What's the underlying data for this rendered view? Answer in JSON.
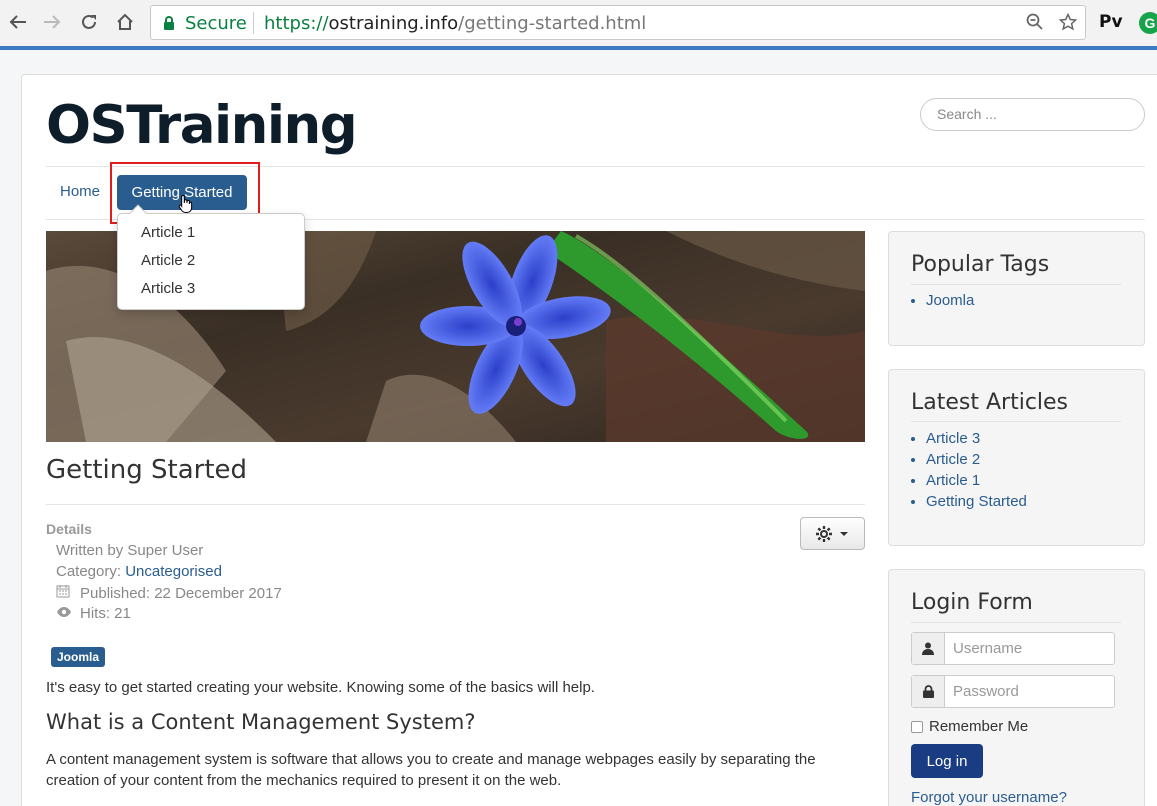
{
  "browser": {
    "secure_label": "Secure",
    "url_scheme": "https://",
    "url_host": "ostraining.info",
    "url_path": "/getting-started.html",
    "extensions": [
      "Pv",
      "G"
    ]
  },
  "site": {
    "brand": "OSTraining",
    "search_placeholder": "Search ..."
  },
  "menu": {
    "home": "Home",
    "active": "Getting Started",
    "dropdown": [
      "Article 1",
      "Article 2",
      "Article 3"
    ]
  },
  "article": {
    "title": "Getting Started",
    "details_label": "Details",
    "written_by": "Written by Super User",
    "category_label": "Category: ",
    "category_value": "Uncategorised",
    "published": "Published: 22 December 2017",
    "hits": "Hits: 21",
    "tag": "Joomla",
    "intro": "It's easy to get started creating your website. Knowing some of the basics will help.",
    "heading": "What is a Content Management System?",
    "para_line1": "A content management system is software that allows you to create and manage webpages easily by separating the",
    "para_line2": "creation of your content from the mechanics required to present it on the web."
  },
  "sidebar": {
    "popular_tags": {
      "title": "Popular Tags",
      "items": [
        "Joomla"
      ]
    },
    "latest_articles": {
      "title": "Latest Articles",
      "items": [
        "Article 3",
        "Article 2",
        "Article 1",
        "Getting Started"
      ]
    },
    "login": {
      "title": "Login Form",
      "username_placeholder": "Username",
      "password_placeholder": "Password",
      "remember": "Remember Me",
      "button": "Log in",
      "forgot": "Forgot your username?"
    }
  },
  "colors": {
    "accent": "#2a5d8f",
    "secure_green": "#0b8043",
    "highlight_red": "#e01e1e",
    "login_button": "#1a3c82"
  }
}
